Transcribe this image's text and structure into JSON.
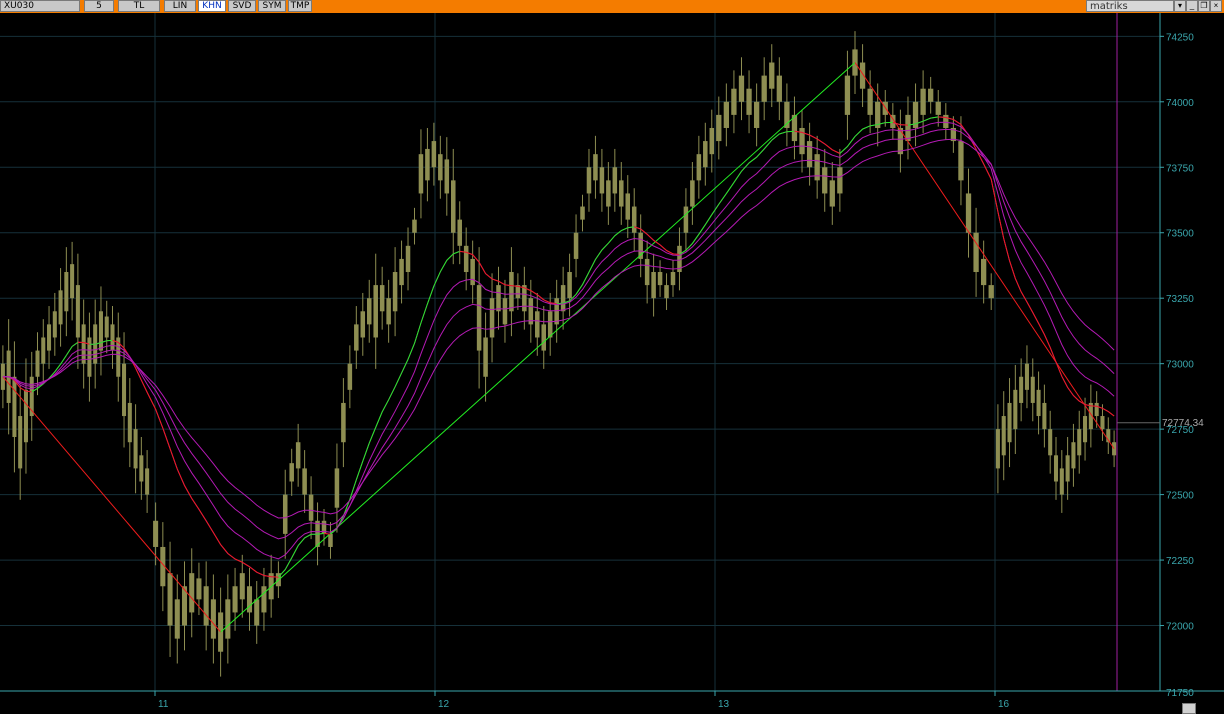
{
  "toolbar": {
    "symbol": "XU030",
    "period": "5",
    "buttons": [
      "TL",
      "LIN",
      "KHN",
      "SVD",
      "SYM",
      "TMP"
    ],
    "active": "KHN",
    "brand": "matriks"
  },
  "colors": {
    "background": "#000000",
    "candle": "#8e8e52",
    "grid": "#16313a",
    "axis": "#3aa6ad",
    "ribbon_up": "#22ee22",
    "ribbon_down": "#ee1c1c",
    "ribbon_band": "#b41ab4",
    "cursor_line": "#a020a0"
  },
  "chart_data": {
    "type": "candlestick",
    "symbol": "XU030",
    "interval": "5",
    "ylim": [
      71750,
      74320
    ],
    "y_ticks": [
      72000,
      72250,
      72500,
      72750,
      73000,
      73250,
      73500,
      73750,
      74000,
      74250
    ],
    "y_bottom_label": "71750",
    "x_labels": [
      "11",
      "12",
      "13",
      "16"
    ],
    "last_price": "72774.34",
    "grid": true,
    "segments": [
      {
        "points": [
          [
            72900,
            73000
          ],
          [
            72850,
            73050
          ],
          [
            72720,
            72950
          ],
          [
            72600,
            72800
          ],
          [
            72700,
            72900
          ],
          [
            72800,
            72950
          ],
          [
            72950,
            73050
          ],
          [
            73000,
            73100
          ],
          [
            73050,
            73150
          ],
          [
            73100,
            73200
          ],
          [
            73150,
            73280
          ],
          [
            73200,
            73350
          ],
          [
            73250,
            73380
          ],
          [
            73100,
            73300
          ],
          [
            73000,
            73150
          ],
          [
            72950,
            73100
          ],
          [
            73000,
            73150
          ],
          [
            73050,
            73200
          ],
          [
            73100,
            73180
          ],
          [
            73050,
            73150
          ],
          [
            72950,
            73100
          ],
          [
            72800,
            73000
          ],
          [
            72700,
            72850
          ],
          [
            72600,
            72750
          ],
          [
            72550,
            72650
          ],
          [
            72500,
            72600
          ]
        ]
      },
      {
        "points": [
          [
            72300,
            72400
          ],
          [
            72150,
            72300
          ],
          [
            72000,
            72200
          ],
          [
            71950,
            72100
          ],
          [
            72000,
            72150
          ],
          [
            72050,
            72200
          ],
          [
            72100,
            72180
          ],
          [
            72000,
            72150
          ],
          [
            71950,
            72100
          ],
          [
            71900,
            72050
          ],
          [
            71950,
            72100
          ],
          [
            72050,
            72150
          ],
          [
            72100,
            72200
          ],
          [
            72050,
            72150
          ],
          [
            72000,
            72100
          ],
          [
            72050,
            72150
          ],
          [
            72100,
            72200
          ],
          [
            72150,
            72200
          ]
        ]
      },
      {
        "points": [
          [
            72350,
            72500
          ],
          [
            72550,
            72620
          ],
          [
            72600,
            72700
          ],
          [
            72500,
            72600
          ],
          [
            72400,
            72500
          ],
          [
            72300,
            72400
          ],
          [
            72350,
            72400
          ],
          [
            72300,
            72350
          ],
          [
            72450,
            72600
          ],
          [
            72700,
            72850
          ],
          [
            72900,
            73000
          ],
          [
            73050,
            73150
          ],
          [
            73100,
            73200
          ],
          [
            73150,
            73250
          ],
          [
            73100,
            73300
          ],
          [
            73200,
            73300
          ],
          [
            73150,
            73250
          ],
          [
            73200,
            73350
          ],
          [
            73300,
            73400
          ],
          [
            73350,
            73450
          ],
          [
            73500,
            73550
          ],
          [
            73650,
            73800
          ],
          [
            73700,
            73820
          ],
          [
            73750,
            73850
          ],
          [
            73700,
            73800
          ],
          [
            73650,
            73780
          ],
          [
            73500,
            73700
          ],
          [
            73450,
            73550
          ],
          [
            73350,
            73450
          ],
          [
            73300,
            73400
          ],
          [
            73050,
            73300
          ],
          [
            72950,
            73100
          ],
          [
            73100,
            73250
          ],
          [
            73200,
            73300
          ],
          [
            73150,
            73250
          ],
          [
            73200,
            73350
          ],
          [
            73250,
            73300
          ],
          [
            73200,
            73300
          ],
          [
            73150,
            73250
          ],
          [
            73100,
            73200
          ],
          [
            73050,
            73150
          ],
          [
            73100,
            73200
          ],
          [
            73150,
            73250
          ],
          [
            73200,
            73300
          ],
          [
            73250,
            73350
          ],
          [
            73400,
            73500
          ],
          [
            73550,
            73600
          ],
          [
            73650,
            73750
          ],
          [
            73700,
            73800
          ],
          [
            73650,
            73750
          ],
          [
            73600,
            73700
          ],
          [
            73650,
            73750
          ],
          [
            73600,
            73700
          ],
          [
            73550,
            73650
          ],
          [
            73500,
            73600
          ],
          [
            73400,
            73500
          ],
          [
            73300,
            73400
          ],
          [
            73250,
            73350
          ],
          [
            73300,
            73350
          ],
          [
            73250,
            73300
          ],
          [
            73300,
            73350
          ],
          [
            73350,
            73450
          ],
          [
            73500,
            73600
          ],
          [
            73600,
            73700
          ],
          [
            73700,
            73800
          ],
          [
            73750,
            73850
          ],
          [
            73800,
            73900
          ]
        ]
      },
      {
        "points": [
          [
            73850,
            73950
          ],
          [
            73900,
            74000
          ],
          [
            73950,
            74050
          ],
          [
            74000,
            74100
          ],
          [
            73950,
            74050
          ],
          [
            73900,
            74000
          ],
          [
            74000,
            74100
          ],
          [
            74050,
            74150
          ],
          [
            74000,
            74100
          ],
          [
            73900,
            74000
          ],
          [
            73850,
            73950
          ],
          [
            73800,
            73900
          ],
          [
            73750,
            73850
          ],
          [
            73700,
            73800
          ],
          [
            73650,
            73750
          ],
          [
            73600,
            73700
          ],
          [
            73650,
            73750
          ],
          [
            73950,
            74100
          ],
          [
            74100,
            74200
          ],
          [
            74050,
            74150
          ],
          [
            73950,
            74050
          ],
          [
            73900,
            74000
          ],
          [
            73950,
            74000
          ],
          [
            73900,
            73950
          ],
          [
            73800,
            73900
          ],
          [
            73850,
            73950
          ],
          [
            73900,
            74000
          ],
          [
            73950,
            74050
          ],
          [
            74000,
            74050
          ],
          [
            73950,
            74000
          ],
          [
            73900,
            73950
          ],
          [
            73850,
            73900
          ],
          [
            73700,
            73850
          ],
          [
            73500,
            73650
          ],
          [
            73350,
            73500
          ],
          [
            73300,
            73400
          ],
          [
            73250,
            73300
          ]
        ]
      },
      {
        "points": [
          [
            72600,
            72750
          ],
          [
            72650,
            72800
          ],
          [
            72700,
            72850
          ],
          [
            72750,
            72900
          ],
          [
            72850,
            72950
          ],
          [
            72900,
            73000
          ],
          [
            72850,
            72950
          ],
          [
            72800,
            72900
          ],
          [
            72750,
            72850
          ],
          [
            72650,
            72750
          ],
          [
            72550,
            72650
          ],
          [
            72500,
            72600
          ],
          [
            72550,
            72650
          ],
          [
            72600,
            72700
          ],
          [
            72650,
            72750
          ],
          [
            72700,
            72800
          ],
          [
            72750,
            72850
          ],
          [
            72800,
            72850
          ],
          [
            72750,
            72800
          ],
          [
            72700,
            72750
          ],
          [
            72650,
            72700
          ]
        ]
      }
    ]
  }
}
